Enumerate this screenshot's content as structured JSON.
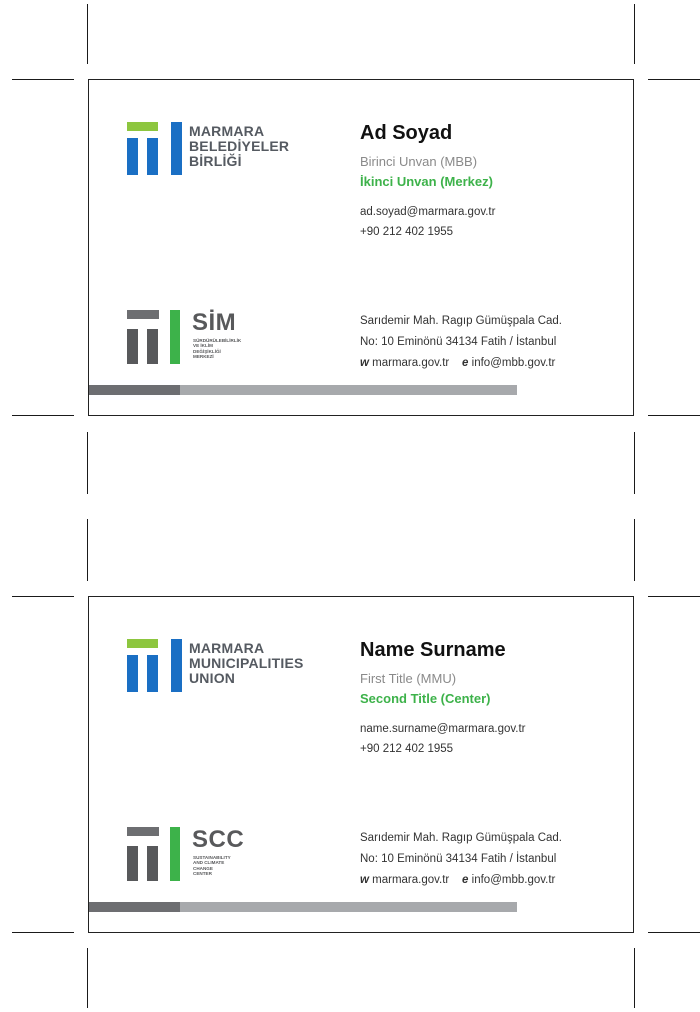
{
  "cards": [
    {
      "logo_lines": [
        "MARMARA",
        "BELEDİYELER",
        "BİRLİĞİ"
      ],
      "name": "Ad Soyad",
      "title1": "Birinci Unvan (MBB)",
      "title2": "İkinci Unvan (Merkez)",
      "email": "ad.soyad@marmara.gov.tr",
      "phone": "+90 212 402 1955",
      "sub_abbr": "SİM",
      "sub_lines": [
        "SÜRDÜRÜLEBİLİRLİK",
        "VE İKLİM",
        "DEĞİŞİKLİĞİ",
        "MERKEZİ"
      ],
      "address1": "Sarıdemir Mah. Ragıp Gümüşpala Cad.",
      "address2": "No: 10 Eminönü 34134  Fatih / İstanbul",
      "web_label": "w",
      "web": "marmara.gov.tr",
      "mail_label": "e",
      "mail": "info@mbb.gov.tr"
    },
    {
      "logo_lines": [
        "MARMARA",
        "MUNICIPALITIES",
        "UNION"
      ],
      "name": "Name Surname",
      "title1": "First Title (MMU)",
      "title2": "Second Title (Center)",
      "email": "name.surname@marmara.gov.tr",
      "phone": "+90 212 402 1955",
      "sub_abbr": "SCC",
      "sub_lines": [
        "SUSTAINABILITY",
        "AND CLIMATE",
        "CHANGE",
        "CENTER"
      ],
      "address1": "Sarıdemir Mah. Ragıp Gümüşpala Cad.",
      "address2": "No: 10 Eminönü 34134  Fatih / İstanbul",
      "web_label": "w",
      "web": "marmara.gov.tr",
      "mail_label": "e",
      "mail": "info@mbb.gov.tr"
    }
  ],
  "colors": {
    "brand_blue": "#1a6fc4",
    "brand_green": "#8dc63f",
    "accent_green": "#3db24a",
    "dark_gray": "#58595b"
  }
}
